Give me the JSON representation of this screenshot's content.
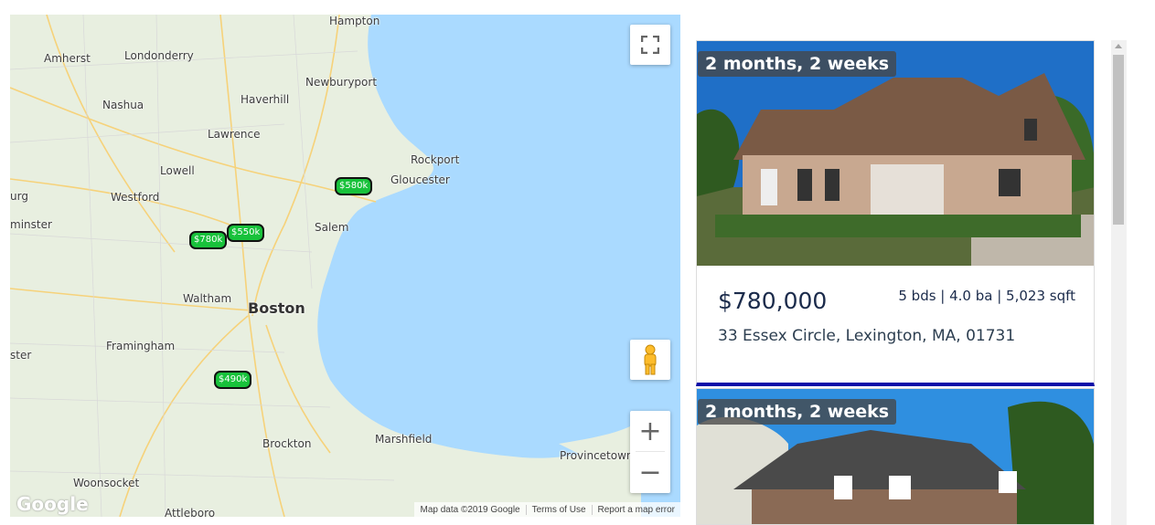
{
  "map": {
    "places": [
      {
        "name": "Hampton"
      },
      {
        "name": "Amherst"
      },
      {
        "name": "Londonderry"
      },
      {
        "name": "Haverhill"
      },
      {
        "name": "Newburyport"
      },
      {
        "name": "Nashua"
      },
      {
        "name": "Lawrence"
      },
      {
        "name": "Lowell"
      },
      {
        "name": "Rockport"
      },
      {
        "name": "Gloucester"
      },
      {
        "name": "urg"
      },
      {
        "name": "Westford"
      },
      {
        "name": "minster"
      },
      {
        "name": "Salem"
      },
      {
        "name": "Waltham"
      },
      {
        "name": "Boston"
      },
      {
        "name": "ster"
      },
      {
        "name": "Framingham"
      },
      {
        "name": "Brockton"
      },
      {
        "name": "Marshfield"
      },
      {
        "name": "Provincetown"
      },
      {
        "name": "Woonsocket"
      },
      {
        "name": "Attleboro"
      }
    ],
    "pins": [
      "$580k",
      "$550k",
      "$780k",
      "$490k"
    ],
    "google_logo": "Google",
    "attribution": [
      "Map data ©2019 Google",
      "Terms of Use",
      "Report a map error"
    ],
    "water_color": "#aadaff",
    "land_color": "#e8efe0",
    "pin_color": "#18c23b"
  },
  "listings": [
    {
      "age": "2 months, 2 weeks",
      "price": "$780,000",
      "specs": "5 bds | 4.0 ba | 5,023 sqft",
      "address": "33 Essex Circle, Lexington, MA, 01731"
    },
    {
      "age": "2 months, 2 weeks"
    }
  ],
  "icons": {
    "fullscreen": "fullscreen-icon",
    "pegman": "pegman-icon",
    "zoom_in": "+",
    "zoom_out": "−"
  }
}
